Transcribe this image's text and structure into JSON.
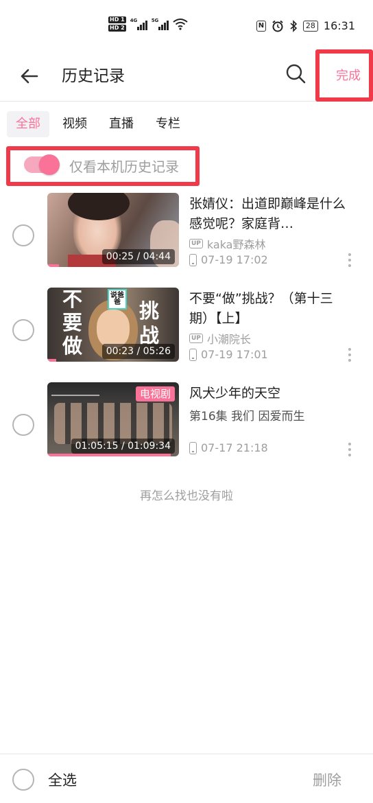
{
  "status_bar": {
    "hd1": "HD 1",
    "hd2": "HD 2",
    "net1": "4G",
    "net2": "5G",
    "battery": "28",
    "time": "16:31",
    "icons": [
      "nfc-icon",
      "alarm-icon",
      "bluetooth-icon",
      "wifi-icon",
      "signal-icon"
    ]
  },
  "header": {
    "title": "历史记录",
    "done_label": "完成"
  },
  "tabs": [
    {
      "label": "全部",
      "active": true
    },
    {
      "label": "视频",
      "active": false
    },
    {
      "label": "直播",
      "active": false
    },
    {
      "label": "专栏",
      "active": false
    }
  ],
  "toggle": {
    "label": "仅看本机历史记录",
    "on": true
  },
  "items": [
    {
      "title": "张婧仪：出道即巅峰是什么感觉呢？家庭背…",
      "up_badge": "UP",
      "uploader": "kaka野森林",
      "date": "07-19 17:02",
      "duration": "00:25 / 04:44",
      "watched_fraction": 0.09
    },
    {
      "title": "不要“做”挑战？（第十三期）【上】",
      "up_badge": "UP",
      "uploader": "小潮院长",
      "date": "07-19 17:01",
      "duration": "00:23 / 05:26",
      "watched_fraction": 0.07,
      "thumb_text": {
        "left_big": "不要做",
        "right_big": "挑战",
        "sticker": "说爸爸"
      }
    },
    {
      "title": "风犬少年的天空",
      "subtitle": "第16集 我们 因爱而生",
      "badge": "电视剧",
      "date": "07-17 21:18",
      "duration": "01:05:15 / 01:09:34",
      "watched_fraction": 0.94
    }
  ],
  "end_note": "再怎么找也没有啦",
  "bottom_bar": {
    "select_all_label": "全选",
    "delete_label": "删除"
  },
  "colors": {
    "accent": "#fb7299",
    "highlight_box": "#f03a4a",
    "muted_text": "#9e9e9e"
  }
}
